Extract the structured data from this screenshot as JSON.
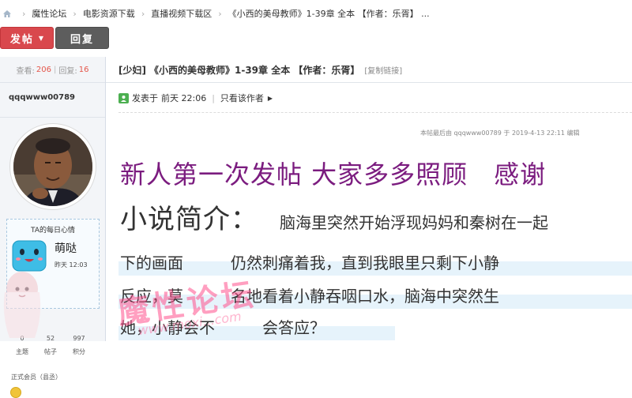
{
  "breadcrumb": {
    "items": [
      "魔性论坛",
      "电影资源下载",
      "直播视频下载区"
    ],
    "current": "《小西的美母教师》1-39章 全本 【作者：乐胥】 ..."
  },
  "actions": {
    "post_label": "发帖",
    "reply_label": "回复"
  },
  "stats": {
    "views_label": "查看:",
    "views": "206",
    "replies_label": "回复:",
    "replies": "16"
  },
  "thread": {
    "category": "[少妇]",
    "title": "《小西的美母教师》1-39章 全本 【作者：乐胥】",
    "copy_link": "[复制链接]"
  },
  "author": {
    "username": "qqqwww00789",
    "posted_prefix": "发表于",
    "posted_time": "前天 22:06",
    "only_author": "只看该作者"
  },
  "mood": {
    "title": "TA的每日心情",
    "name": "萌哒",
    "time": "昨天 12:03"
  },
  "user_counts": {
    "values": [
      "0",
      "52",
      "997"
    ],
    "labels": [
      "主题",
      "帖子",
      "积分"
    ]
  },
  "rank": "正式会员（县丞）",
  "edit_note": "本帖最后由 qqqwww00789 于 2019-4-13 22:11 编辑",
  "content": {
    "headline": "新人第一次发帖 大家多多照顾　感谢",
    "intro_label": "小说简介：",
    "lines": [
      "脑海里突然开始浮现妈妈和秦树在一起",
      "下的画面　　　仍然刺痛着我，直到我眼里只剩下小静",
      "反应，莫　　　名地看着小静吞咽口水，脑海中突然生",
      "她，小静会不　　　会答应？"
    ]
  },
  "watermark": {
    "text": "魔性论坛",
    "url": "www.moxi...com"
  },
  "colors": {
    "post_button": "#d9484d",
    "reply_button": "#5d5d5d",
    "headline": "#7b1c7f",
    "accent_num": "#e4564a"
  }
}
